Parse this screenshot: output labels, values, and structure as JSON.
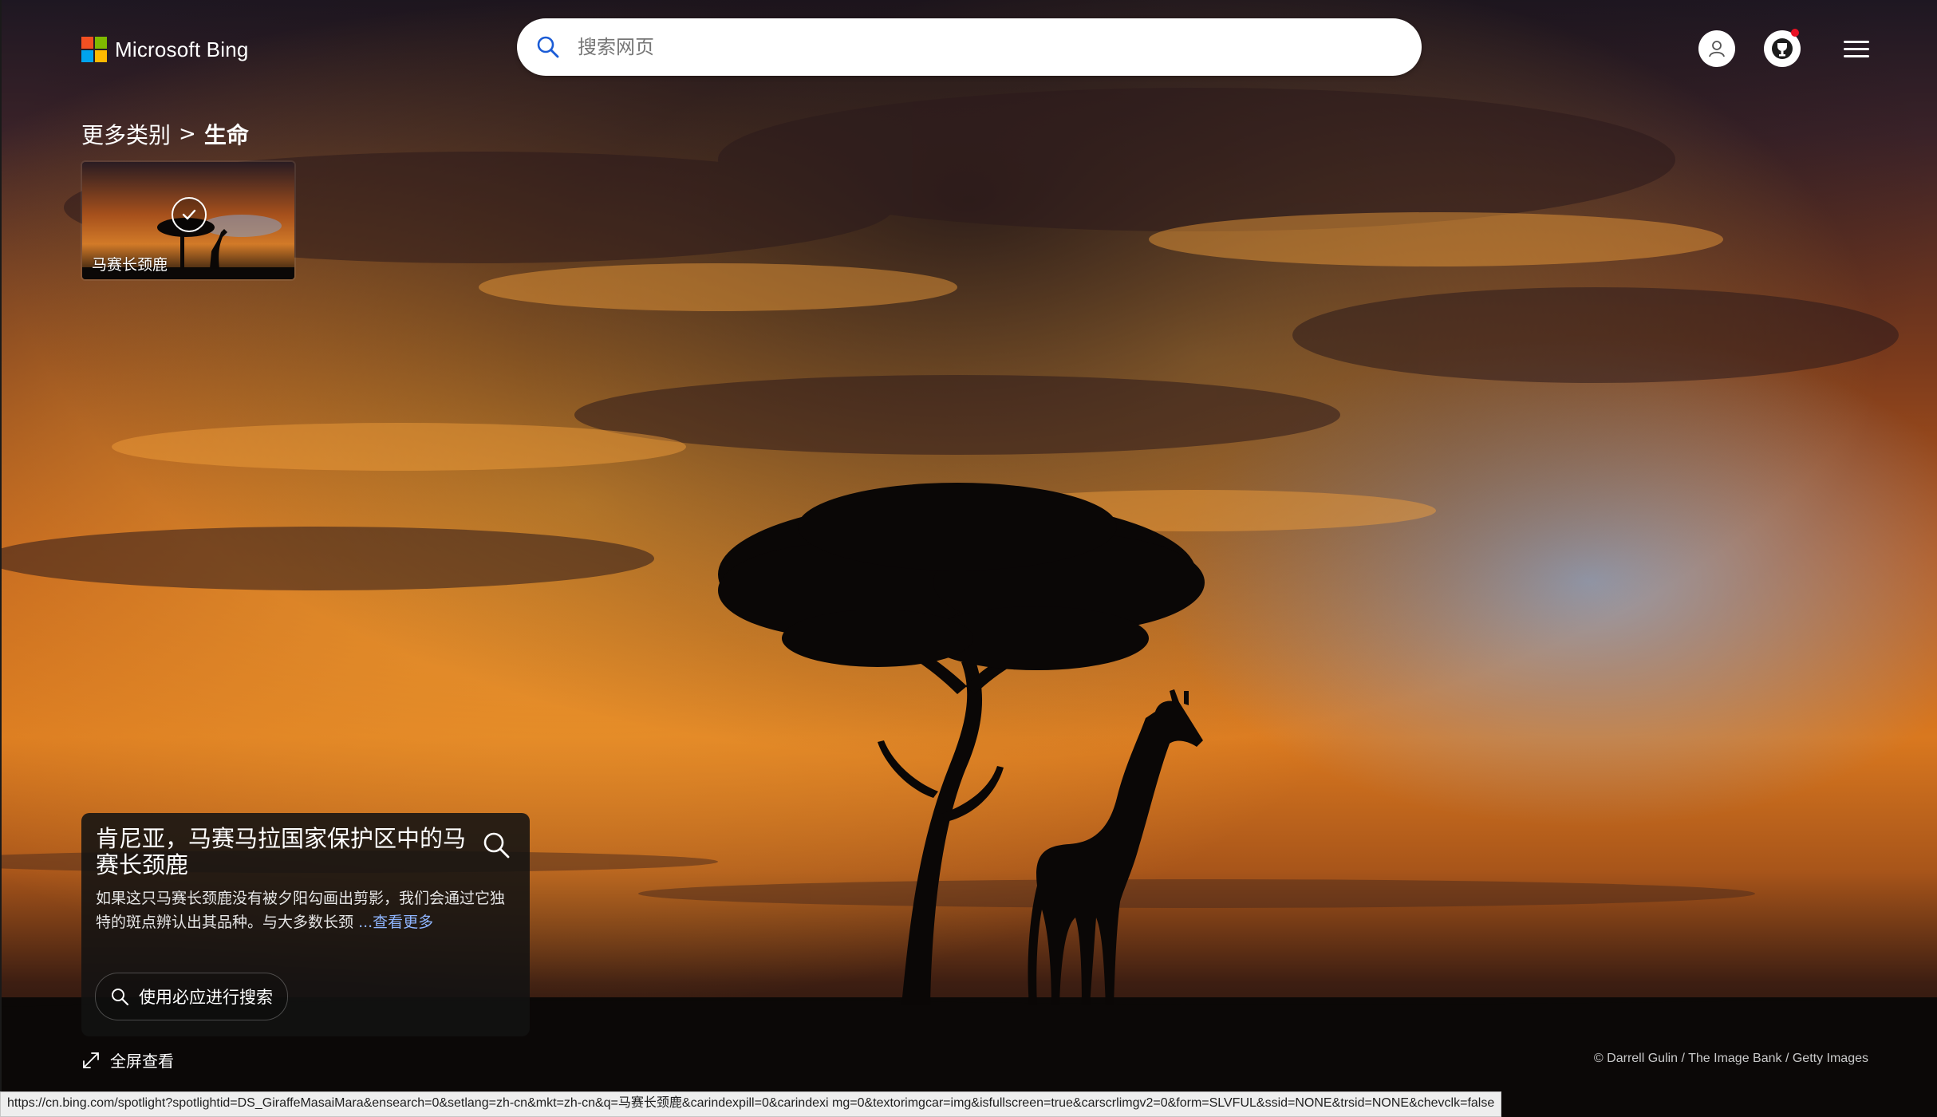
{
  "header": {
    "brand": "Microsoft Bing",
    "brand_colors": [
      "#F25022",
      "#7FBA00",
      "#00A4EF",
      "#FFB900"
    ],
    "search": {
      "placeholder": "搜索网页",
      "value": ""
    },
    "icons": {
      "search": "search-icon",
      "profile": "user-icon",
      "rewards": "trophy-icon",
      "menu": "hamburger-menu-icon"
    },
    "notification_color": "#E81123"
  },
  "breadcrumb": {
    "parent": "更多类别",
    "separator": ">",
    "current": "生命"
  },
  "thumbnail": {
    "label": "马赛长颈鹿",
    "selected": true,
    "icon": "checkmark-icon"
  },
  "card": {
    "title": "肯尼亚，马赛马拉国家保护区中的马赛长颈鹿",
    "description": "如果这只马赛长颈鹿没有被夕阳勾画出剪影，我们会通过它独特的斑点辨认出其品种。与大多数长颈",
    "more_link": "...查看更多",
    "more_link_color": "#8FB5FF",
    "search_button": "使用必应进行搜索"
  },
  "fullscreen_label": "全屏查看",
  "copyright": "© Darrell Gulin / The Image Bank / Getty Images",
  "status_url": "https://cn.bing.com/spotlight?spotlightid=DS_GiraffeMasaiMara&ensearch=0&setlang=zh-cn&mkt=zh-cn&q=马赛长颈鹿&carindexpill=0&carindexi mg=0&textorimgcar=img&isfullscreen=true&carscrlimgv2=0&form=SLVFUL&ssid=NONE&trsid=NONE&chevclk=false"
}
